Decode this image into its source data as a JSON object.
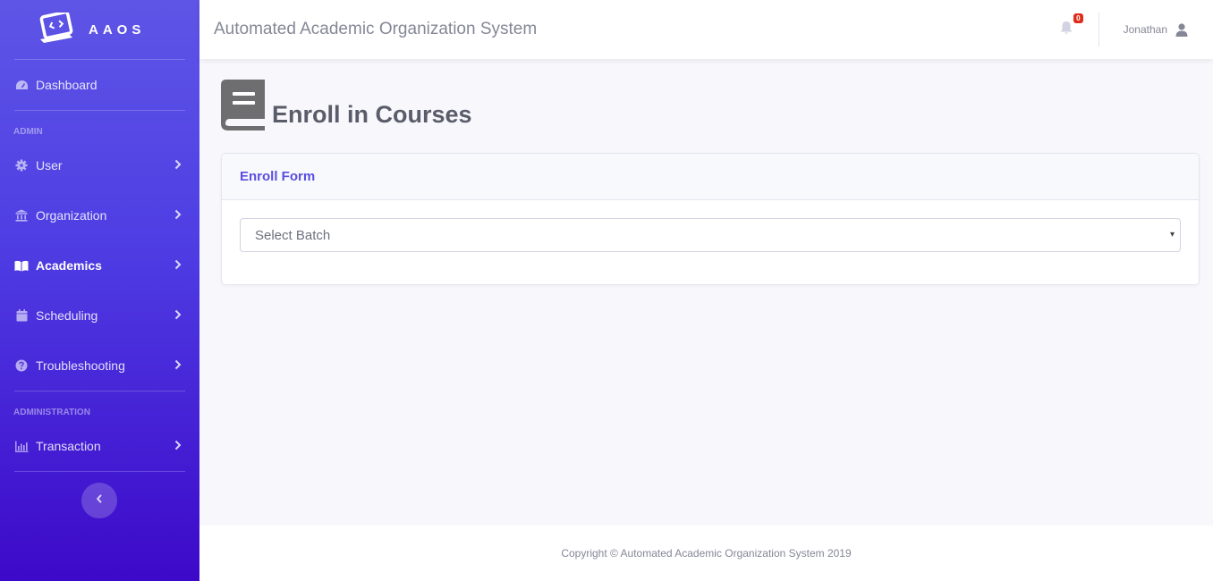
{
  "brand": {
    "name": "AAOS"
  },
  "sidebar": {
    "dashboard": "Dashboard",
    "section_admin": "ADMIN",
    "section_administration": "ADMINISTRATION",
    "items": [
      {
        "label": "User",
        "icon": "gear-icon"
      },
      {
        "label": "Organization",
        "icon": "bank-icon"
      },
      {
        "label": "Academics",
        "icon": "book-open-icon"
      },
      {
        "label": "Scheduling",
        "icon": "calendar-icon"
      },
      {
        "label": "Troubleshooting",
        "icon": "question-circle-icon"
      },
      {
        "label": "Transaction",
        "icon": "chart-icon"
      }
    ],
    "active": "Academics"
  },
  "topbar": {
    "title": "Automated Academic Organization System",
    "notification_count": "0",
    "user_name": "Jonathan"
  },
  "page": {
    "title": "Enroll in Courses",
    "card_title": "Enroll Form",
    "select_placeholder": "Select Batch"
  },
  "footer": {
    "copyright": "Copyright © Automated Academic Organization System 2019"
  },
  "colors": {
    "accent": "#5a4ee0",
    "sidebar_top": "#5e55e6",
    "sidebar_bottom": "#3d09c9",
    "badge": "#e02d1b"
  }
}
